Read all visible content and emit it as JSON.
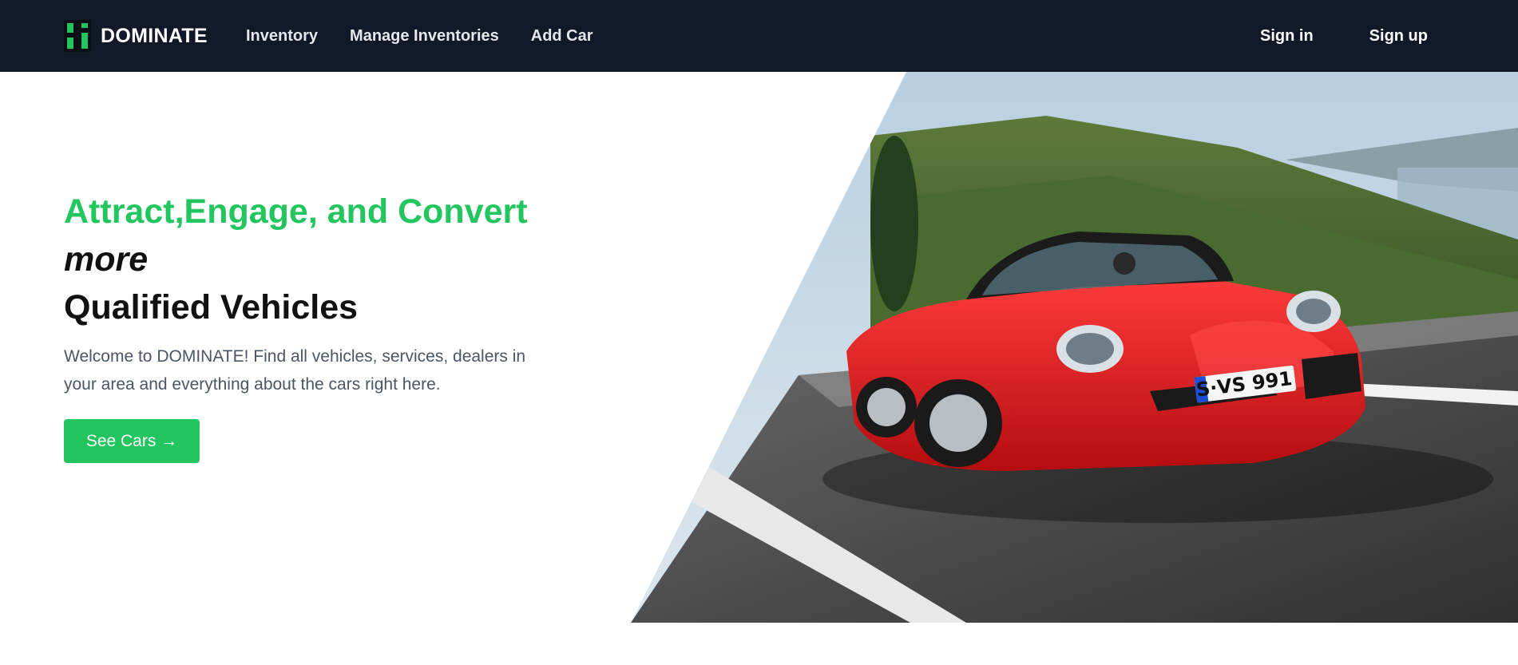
{
  "navbar": {
    "brand": "DOMINATE",
    "links": [
      "Inventory",
      "Manage Inventories",
      "Add Car"
    ],
    "sign_in": "Sign in",
    "sign_up": "Sign up"
  },
  "hero": {
    "headline_accent": "Attract,Engage, and Convert",
    "headline_italic": "more",
    "headline_dark": "Qualified Vehicles",
    "description": "Welcome to DOMINATE! Find all vehicles, services, dealers in your area and everything about the cars right here.",
    "cta_label": "See Cars →",
    "license_plate": "S·VS 991"
  },
  "colors": {
    "navbar_bg": "#111827",
    "accent": "#22c55e"
  }
}
